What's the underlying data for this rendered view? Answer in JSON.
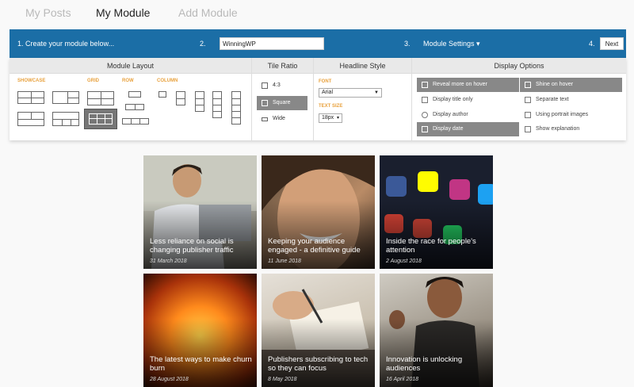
{
  "tabs": [
    {
      "label": "My Posts",
      "active": false
    },
    {
      "label": "My Module",
      "active": true
    },
    {
      "label": "Add Module",
      "active": false
    }
  ],
  "toolbar": {
    "step1": "1. Create your module below...",
    "step2": "2.",
    "name_value": "WinningWP",
    "step3": "3.",
    "settings_label": "Module Settings ▾",
    "step4": "4.",
    "next_label": "Next"
  },
  "sections": {
    "layout": "Module Layout",
    "ratio": "Tile Ratio",
    "headline": "Headline Style",
    "display": "Display Options"
  },
  "layout_groups": [
    "SHOWCASE",
    "GRID",
    "ROW",
    "COLUMN"
  ],
  "ratios": [
    {
      "label": "4:3",
      "selected": false
    },
    {
      "label": "Square",
      "selected": true
    },
    {
      "label": "Wide",
      "selected": false
    }
  ],
  "headline": {
    "font_label": "FONT",
    "font_value": "Arial",
    "size_label": "TEXT SIZE",
    "size_value": "18px"
  },
  "display_options": [
    {
      "label": "Reveal more on hover",
      "selected": true,
      "icon": "hover-icon"
    },
    {
      "label": "Shine on hover",
      "selected": true,
      "icon": "shine-icon"
    },
    {
      "label": "Display title only",
      "selected": false,
      "icon": "title-icon"
    },
    {
      "label": "Separate text",
      "selected": false,
      "icon": "text-icon"
    },
    {
      "label": "Display author",
      "selected": false,
      "icon": "author-icon"
    },
    {
      "label": "Using portrait images",
      "selected": false,
      "icon": "portrait-icon"
    },
    {
      "label": "Display date",
      "selected": true,
      "icon": "calendar-icon"
    },
    {
      "label": "Show explanation",
      "selected": false,
      "icon": "comment-icon"
    }
  ],
  "articles": [
    {
      "title": "Less reliance on social is changing publisher traffic",
      "date": "31 March 2018"
    },
    {
      "title": "Keeping your audience engaged - a definitive guide",
      "date": "11 June 2018"
    },
    {
      "title": "Inside the race for people's attention",
      "date": "2 August 2018"
    },
    {
      "title": "The latest ways to make churn burn",
      "date": "28 August 2018"
    },
    {
      "title": "Publishers subscribing to tech so they can focus",
      "date": "8 May 2018"
    },
    {
      "title": "Innovation is unlocking audiences",
      "date": "16 April 2018"
    }
  ],
  "colors": {
    "toolbar": "#1b6ea6",
    "accent_label": "#e8a13d",
    "selected": "#888888"
  }
}
